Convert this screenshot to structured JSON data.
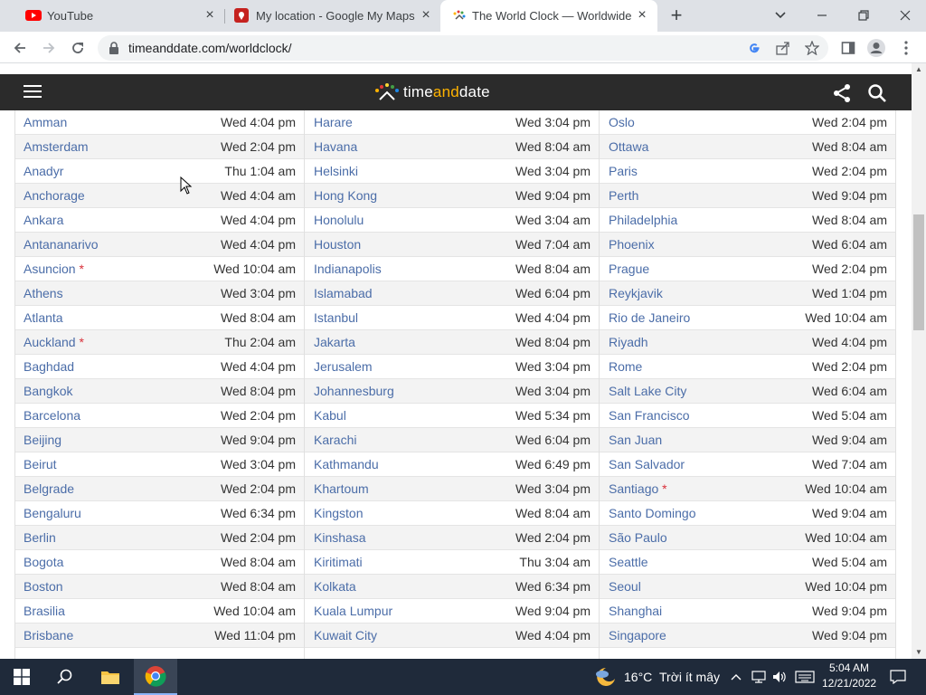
{
  "browser": {
    "tabs": [
      {
        "title": "YouTube",
        "icon": "youtube-icon",
        "active": false
      },
      {
        "title": "My location - Google My Maps",
        "icon": "maps-icon",
        "active": false
      },
      {
        "title": "The World Clock — Worldwide",
        "icon": "timeanddate-icon",
        "active": true
      }
    ],
    "url": "timeanddate.com/worldclock/"
  },
  "site": {
    "logo_text_1": "time",
    "logo_text_2": "and",
    "logo_text_3": "date"
  },
  "columns": [
    [
      {
        "city": "Amman",
        "dst": false,
        "time": "Wed 4:04 pm"
      },
      {
        "city": "Amsterdam",
        "dst": false,
        "time": "Wed 2:04 pm"
      },
      {
        "city": "Anadyr",
        "dst": false,
        "time": "Thu 1:04 am"
      },
      {
        "city": "Anchorage",
        "dst": false,
        "time": "Wed 4:04 am"
      },
      {
        "city": "Ankara",
        "dst": false,
        "time": "Wed 4:04 pm"
      },
      {
        "city": "Antananarivo",
        "dst": false,
        "time": "Wed 4:04 pm"
      },
      {
        "city": "Asuncion",
        "dst": true,
        "time": "Wed 10:04 am"
      },
      {
        "city": "Athens",
        "dst": false,
        "time": "Wed 3:04 pm"
      },
      {
        "city": "Atlanta",
        "dst": false,
        "time": "Wed 8:04 am"
      },
      {
        "city": "Auckland",
        "dst": true,
        "time": "Thu 2:04 am"
      },
      {
        "city": "Baghdad",
        "dst": false,
        "time": "Wed 4:04 pm"
      },
      {
        "city": "Bangkok",
        "dst": false,
        "time": "Wed 8:04 pm"
      },
      {
        "city": "Barcelona",
        "dst": false,
        "time": "Wed 2:04 pm"
      },
      {
        "city": "Beijing",
        "dst": false,
        "time": "Wed 9:04 pm"
      },
      {
        "city": "Beirut",
        "dst": false,
        "time": "Wed 3:04 pm"
      },
      {
        "city": "Belgrade",
        "dst": false,
        "time": "Wed 2:04 pm"
      },
      {
        "city": "Bengaluru",
        "dst": false,
        "time": "Wed 6:34 pm"
      },
      {
        "city": "Berlin",
        "dst": false,
        "time": "Wed 2:04 pm"
      },
      {
        "city": "Bogota",
        "dst": false,
        "time": "Wed 8:04 am"
      },
      {
        "city": "Boston",
        "dst": false,
        "time": "Wed 8:04 am"
      },
      {
        "city": "Brasilia",
        "dst": false,
        "time": "Wed 10:04 am"
      },
      {
        "city": "Brisbane",
        "dst": false,
        "time": "Wed 11:04 pm"
      }
    ],
    [
      {
        "city": "Harare",
        "dst": false,
        "time": "Wed 3:04 pm"
      },
      {
        "city": "Havana",
        "dst": false,
        "time": "Wed 8:04 am"
      },
      {
        "city": "Helsinki",
        "dst": false,
        "time": "Wed 3:04 pm"
      },
      {
        "city": "Hong Kong",
        "dst": false,
        "time": "Wed 9:04 pm"
      },
      {
        "city": "Honolulu",
        "dst": false,
        "time": "Wed 3:04 am"
      },
      {
        "city": "Houston",
        "dst": false,
        "time": "Wed 7:04 am"
      },
      {
        "city": "Indianapolis",
        "dst": false,
        "time": "Wed 8:04 am"
      },
      {
        "city": "Islamabad",
        "dst": false,
        "time": "Wed 6:04 pm"
      },
      {
        "city": "Istanbul",
        "dst": false,
        "time": "Wed 4:04 pm"
      },
      {
        "city": "Jakarta",
        "dst": false,
        "time": "Wed 8:04 pm"
      },
      {
        "city": "Jerusalem",
        "dst": false,
        "time": "Wed 3:04 pm"
      },
      {
        "city": "Johannesburg",
        "dst": false,
        "time": "Wed 3:04 pm"
      },
      {
        "city": "Kabul",
        "dst": false,
        "time": "Wed 5:34 pm"
      },
      {
        "city": "Karachi",
        "dst": false,
        "time": "Wed 6:04 pm"
      },
      {
        "city": "Kathmandu",
        "dst": false,
        "time": "Wed 6:49 pm"
      },
      {
        "city": "Khartoum",
        "dst": false,
        "time": "Wed 3:04 pm"
      },
      {
        "city": "Kingston",
        "dst": false,
        "time": "Wed 8:04 am"
      },
      {
        "city": "Kinshasa",
        "dst": false,
        "time": "Wed 2:04 pm"
      },
      {
        "city": "Kiritimati",
        "dst": false,
        "time": "Thu 3:04 am"
      },
      {
        "city": "Kolkata",
        "dst": false,
        "time": "Wed 6:34 pm"
      },
      {
        "city": "Kuala Lumpur",
        "dst": false,
        "time": "Wed 9:04 pm"
      },
      {
        "city": "Kuwait City",
        "dst": false,
        "time": "Wed 4:04 pm"
      }
    ],
    [
      {
        "city": "Oslo",
        "dst": false,
        "time": "Wed 2:04 pm"
      },
      {
        "city": "Ottawa",
        "dst": false,
        "time": "Wed 8:04 am"
      },
      {
        "city": "Paris",
        "dst": false,
        "time": "Wed 2:04 pm"
      },
      {
        "city": "Perth",
        "dst": false,
        "time": "Wed 9:04 pm"
      },
      {
        "city": "Philadelphia",
        "dst": false,
        "time": "Wed 8:04 am"
      },
      {
        "city": "Phoenix",
        "dst": false,
        "time": "Wed 6:04 am"
      },
      {
        "city": "Prague",
        "dst": false,
        "time": "Wed 2:04 pm"
      },
      {
        "city": "Reykjavik",
        "dst": false,
        "time": "Wed 1:04 pm"
      },
      {
        "city": "Rio de Janeiro",
        "dst": false,
        "time": "Wed 10:04 am"
      },
      {
        "city": "Riyadh",
        "dst": false,
        "time": "Wed 4:04 pm"
      },
      {
        "city": "Rome",
        "dst": false,
        "time": "Wed 2:04 pm"
      },
      {
        "city": "Salt Lake City",
        "dst": false,
        "time": "Wed 6:04 am"
      },
      {
        "city": "San Francisco",
        "dst": false,
        "time": "Wed 5:04 am"
      },
      {
        "city": "San Juan",
        "dst": false,
        "time": "Wed 9:04 am"
      },
      {
        "city": "San Salvador",
        "dst": false,
        "time": "Wed 7:04 am"
      },
      {
        "city": "Santiago",
        "dst": true,
        "time": "Wed 10:04 am"
      },
      {
        "city": "Santo Domingo",
        "dst": false,
        "time": "Wed 9:04 am"
      },
      {
        "city": "São Paulo",
        "dst": false,
        "time": "Wed 10:04 am"
      },
      {
        "city": "Seattle",
        "dst": false,
        "time": "Wed 5:04 am"
      },
      {
        "city": "Seoul",
        "dst": false,
        "time": "Wed 10:04 pm"
      },
      {
        "city": "Shanghai",
        "dst": false,
        "time": "Wed 9:04 pm"
      },
      {
        "city": "Singapore",
        "dst": false,
        "time": "Wed 9:04 pm"
      }
    ]
  ],
  "dst_marker": "*",
  "taskbar": {
    "weather_temp": "16°C",
    "weather_desc": "Trời ít mây",
    "time": "5:04 AM",
    "date": "12/21/2022"
  },
  "colors": {
    "link": "#4b6da8",
    "dst_marker": "#d9303a",
    "header_bg": "#2b2b2b",
    "logo_accent": "#ffb300"
  }
}
